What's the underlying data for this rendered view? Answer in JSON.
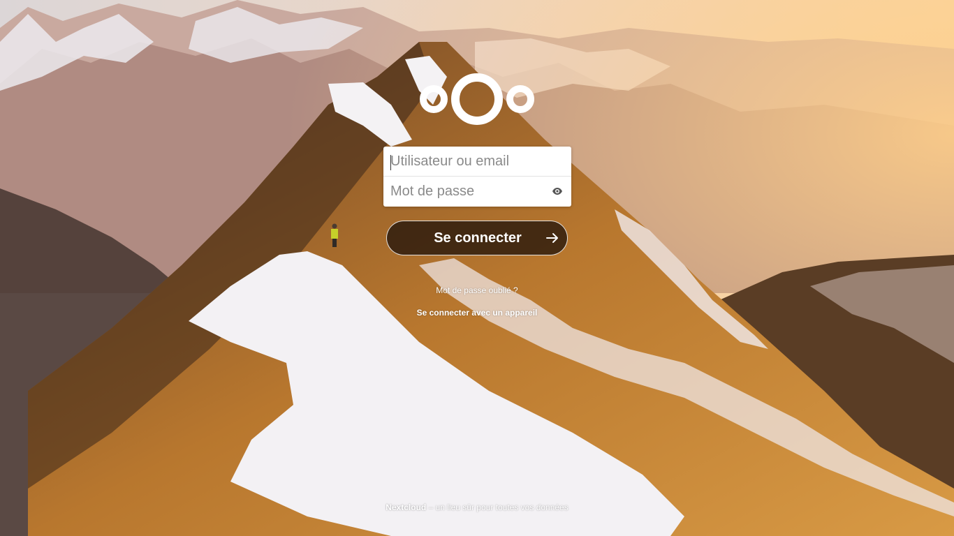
{
  "login": {
    "username_placeholder": "Utilisateur ou email",
    "password_placeholder": "Mot de passe",
    "submit_label": "Se connecter",
    "forgot_password_link": "Mot de passe oublié ?",
    "device_login_link": "Se connecter avec un appareil"
  },
  "footer": {
    "brand": "Nextcloud",
    "tagline": " – un lieu sûr pour toutes vos données"
  },
  "icons": {
    "logo": "nextcloud-logo",
    "password_toggle": "eye-icon",
    "submit": "arrow-right-icon"
  },
  "colors": {
    "field_background": "#ffffff",
    "button_background": "#190e08",
    "text_light": "#ffffff"
  }
}
